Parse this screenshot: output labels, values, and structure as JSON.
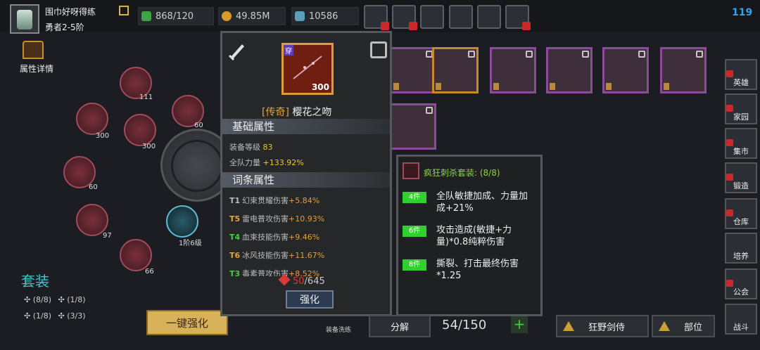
{
  "player": {
    "name": "围巾好呀得练",
    "rank": "勇者2-5阶"
  },
  "stats": [
    {
      "icon": "energy-icon",
      "value": "868/120"
    },
    {
      "icon": "gold-coin-icon",
      "value": "49.85M"
    },
    {
      "icon": "gem-icon",
      "value": "10586"
    }
  ],
  "top_icons": [
    "shop-cart-icon",
    "mail-icon",
    "gamepad-icon",
    "settings-gear-icon",
    "color-wheel-icon",
    "star-burst-icon"
  ],
  "top_counter": "119",
  "attrs_detail": "属性详情",
  "node_labels": [
    "111",
    "300",
    "300",
    "60",
    "60",
    "97",
    "66",
    "1阶6级"
  ],
  "set_section": {
    "title": "套装",
    "rows": [
      [
        "(8/8)",
        "(1/8)"
      ],
      [
        "(1/8)",
        "(3/3)"
      ]
    ]
  },
  "strengthen_all": "一键强化",
  "reforge_label": "装备洗练",
  "tooltip": {
    "item_badge": "穿",
    "item_level": "300",
    "quality": "[传奇]",
    "name": "樱花之吻",
    "base_header": "基础属性",
    "base_rows": [
      {
        "label": "装备等级",
        "value": "83"
      },
      {
        "label": "全队力量",
        "value": "+133.92%"
      }
    ],
    "affix_header": "词条属性",
    "affixes": [
      {
        "tier": "T1",
        "tier_color": "#bbbbbb",
        "label": "幻束贯耀伤害",
        "value": "+5.84%"
      },
      {
        "tier": "T5",
        "tier_color": "#e6a23c",
        "label": "雷电普攻伤害",
        "value": "+10.93%"
      },
      {
        "tier": "T4",
        "tier_color": "#3fcf3f",
        "label": "血束技能伤害",
        "value": "+9.46%"
      },
      {
        "tier": "T6",
        "tier_color": "#e6a23c",
        "label": "冰风技能伤害",
        "value": "+11.67%"
      },
      {
        "tier": "T3",
        "tier_color": "#3fcf3f",
        "label": "毒素普攻伤害",
        "value": "+8.52%"
      }
    ],
    "cost_current": "50",
    "cost_total": "/645",
    "strengthen": "强化"
  },
  "set_tooltip": {
    "title": "疯狂刺杀套装: (8/8)",
    "pieces": [
      {
        "count": "4件",
        "text": "全队敏捷加成、力量加成+21%"
      },
      {
        "count": "6件",
        "text": "攻击造成(敏捷+力量)*0.8纯粹伤害"
      },
      {
        "count": "8件",
        "text": "撕裂、打击最终伤害*1.25"
      }
    ]
  },
  "sidenav": [
    "英雄",
    "家园",
    "集市",
    "锻造",
    "仓库",
    "培养",
    "公会",
    "战斗"
  ],
  "bottom": {
    "decompose": "分解",
    "counter": "54/150",
    "plus": "+",
    "filter1": "狂野剑侍",
    "filter2": "部位"
  },
  "colors": {
    "accent_teal": "#3bc7c7",
    "legendary": "#e6a23c",
    "set_green": "#2ed12e"
  }
}
